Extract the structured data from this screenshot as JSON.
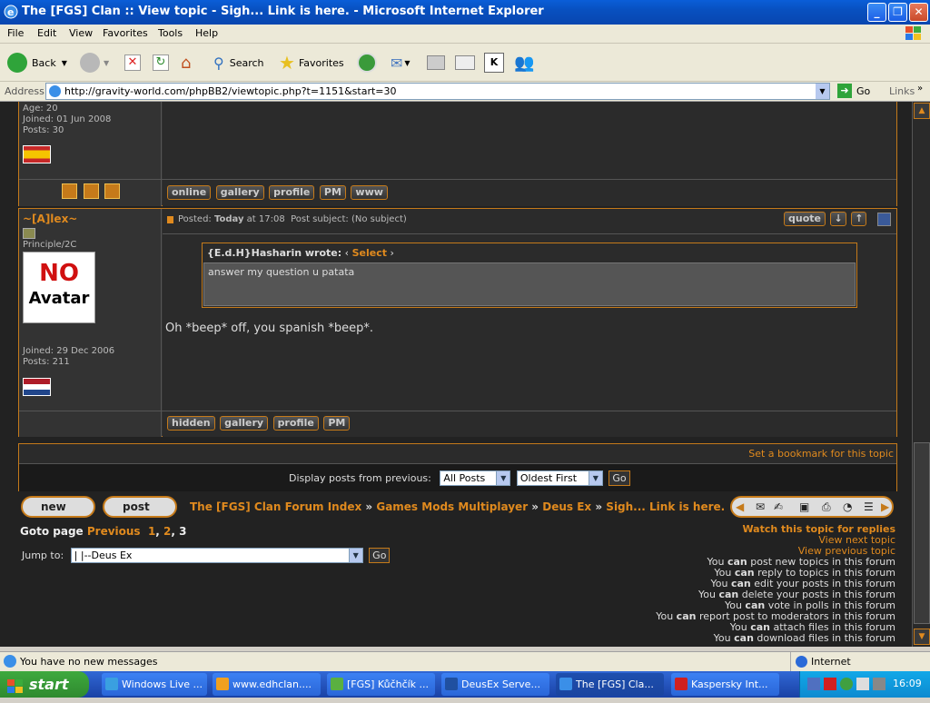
{
  "window": {
    "title": "The [FGS] Clan :: View topic - Sigh... Link is here. - Microsoft Internet Explorer"
  },
  "menu": [
    "File",
    "Edit",
    "View",
    "Favorites",
    "Tools",
    "Help"
  ],
  "toolbar": {
    "back": "Back",
    "search": "Search",
    "favorites": "Favorites"
  },
  "address": {
    "label": "Address",
    "url": "http://gravity-world.com/phpBB2/viewtopic.php?t=1151&start=30",
    "go": "Go",
    "links": "Links"
  },
  "post1": {
    "age": "Age: 20",
    "joined": "Joined: 01 Jun 2008",
    "posts": "Posts: 30",
    "flag": "spain",
    "buttons": [
      "online",
      "gallery",
      "profile",
      "PM",
      "www"
    ]
  },
  "post2": {
    "username": "~[A]lex~",
    "rank": "Principle/2C",
    "avatar_line1": "NO",
    "avatar_line2": "Avatar",
    "joined": "Joined: 29 Dec 2006",
    "posts": "Posts: 211",
    "flag": "netherlands",
    "posted_label": "Posted:",
    "posted_day": "Today",
    "posted_time": "at 17:08",
    "subject": "Post subject:  (No subject)",
    "quote_btn": "quote",
    "quote_author": "{E.d.H}Hasharin wrote:",
    "quote_select_pre": "‹",
    "quote_select": "Select",
    "quote_select_post": "›",
    "quote_text": "answer my question u patata",
    "body": "Oh *beep* off, you spanish *beep*.",
    "buttons": [
      "hidden",
      "gallery",
      "profile",
      "PM"
    ]
  },
  "bookmark": "Set a bookmark for this topic",
  "display": {
    "label": "Display posts from previous:",
    "filter": "All Posts",
    "order": "Oldest First",
    "go": "Go"
  },
  "actions": {
    "new_topic": "new topic",
    "post_reply": "post reply"
  },
  "breadcrumb": {
    "index": "The [FGS] Clan Forum Index",
    "sep": "»",
    "cat": "Games Mods Multiplayer",
    "forum": "Deus Ex",
    "topic": "Sigh... Link is here."
  },
  "goto": {
    "label": "Goto page",
    "previous": "Previous",
    "p1": "1",
    "p2": "2",
    "p3": "3"
  },
  "jump": {
    "label": "Jump to:",
    "value": "|   |--Deus Ex",
    "go": "Go"
  },
  "right_links": [
    "Watch this topic for replies",
    "View next topic",
    "View previous topic"
  ],
  "perms": [
    {
      "pre": "You ",
      "can": "can",
      "post": " post new topics in this forum"
    },
    {
      "pre": "You ",
      "can": "can",
      "post": " reply to topics in this forum"
    },
    {
      "pre": "You ",
      "can": "can",
      "post": " edit your posts in this forum"
    },
    {
      "pre": "You ",
      "can": "can",
      "post": " delete your posts in this forum"
    },
    {
      "pre": "You ",
      "can": "can",
      "post": " vote in polls in this forum"
    },
    {
      "pre": "You ",
      "can": "can",
      "post": " report post to moderators in this forum"
    },
    {
      "pre": "You ",
      "can": "can",
      "post": " attach files in this forum"
    },
    {
      "pre": "You ",
      "can": "can",
      "post": " download files in this forum"
    }
  ],
  "status": {
    "message": "You have no new messages",
    "zone": "Internet"
  },
  "taskbar": {
    "start": "start",
    "tasks": [
      "Windows Live ...",
      "www.edhclan....",
      "[FGS] Kůčhčík ...",
      "DeusEx Serve...",
      "The [FGS] Cla...",
      "Kaspersky Int..."
    ],
    "clock": "16:09"
  },
  "colors": {
    "accent": "#e08a1e",
    "bg": "#222222",
    "panel": "#333333"
  }
}
